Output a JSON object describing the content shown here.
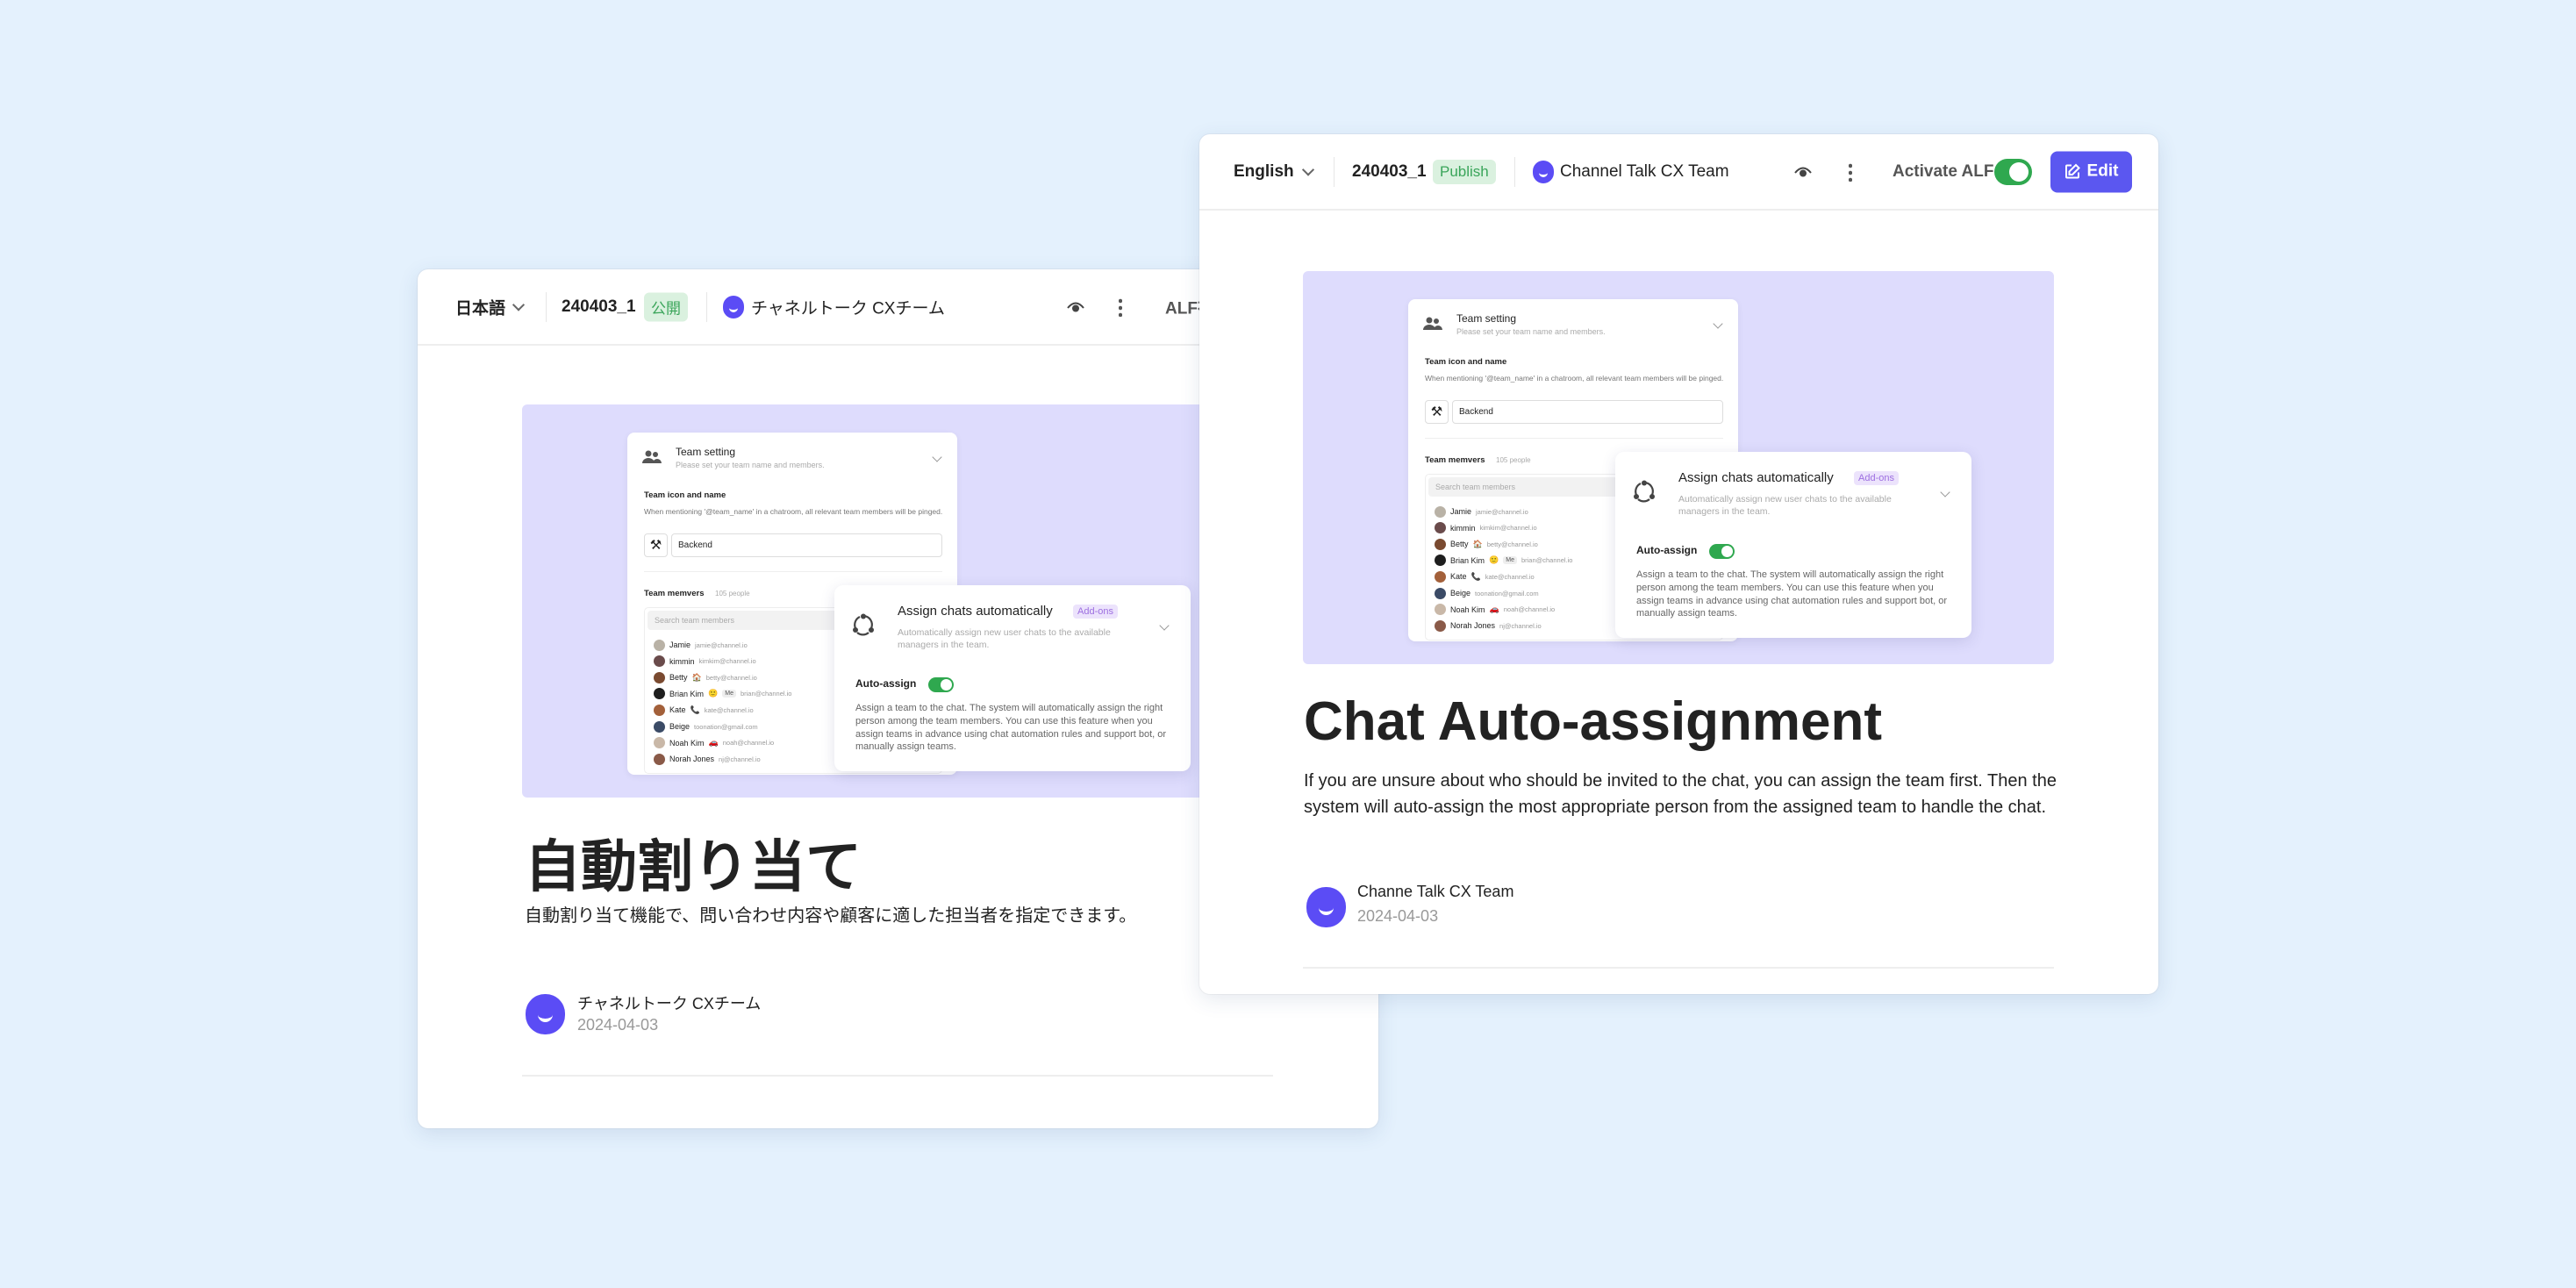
{
  "background_color": "#e4f1fd",
  "accent_color": "#5b57f0",
  "ja": {
    "header": {
      "language": "日本語",
      "version": "240403_1",
      "status": "公開",
      "team": "チャネルトーク CXチーム",
      "alf_label": "ALF有"
    },
    "title": "自動割り当て",
    "description": "自動割り当て機能で、問い合わせ内容や顧客に適した担当者を指定できます。",
    "author": {
      "name": "チャネルトーク CXチーム",
      "date": "2024-04-03"
    }
  },
  "en": {
    "header": {
      "language": "English",
      "version": "240403_1",
      "status": "Publish",
      "team": "Channel Talk CX Team",
      "alf_label": "Activate ALF",
      "alf_enabled": true,
      "edit_label": "Edit"
    },
    "title": "Chat Auto-assignment",
    "description": "If you are unsure about who should be invited to the chat, you can assign the team first. Then the system will auto-assign the most appropriate person from the assigned team to handle the chat.",
    "author": {
      "name": "Channe Talk CX Team",
      "date": "2024-04-03"
    }
  },
  "mockup": {
    "team_setting": {
      "title": "Team setting",
      "subtitle": "Please set your team name and members.",
      "icon_name_label": "Team icon and name",
      "icon_name_desc": "When mentioning '@team_name' in a chatroom, all relevant team members will be pinged.",
      "team_icon": "⚒",
      "team_name_value": "Backend",
      "members_label": "Team memvers",
      "members_count": "105 people",
      "search_placeholder": "Search team members",
      "members": [
        {
          "name": "Jamie",
          "email": "jamie@channel.io",
          "emoji": "",
          "me": "",
          "color": "#b9b2a6"
        },
        {
          "name": "kimmin",
          "email": "kimkim@channel.io",
          "emoji": "",
          "me": "",
          "color": "#6a4b4b"
        },
        {
          "name": "Betty",
          "email": "betty@channel.io",
          "emoji": "🏠",
          "me": "",
          "color": "#7a4a30"
        },
        {
          "name": "Brian Kim",
          "email": "brian@channel.io",
          "emoji": "🙂",
          "me": "Me",
          "color": "#1e1e1e"
        },
        {
          "name": "Kate",
          "email": "kate@channel.io",
          "emoji": "📞",
          "me": "",
          "color": "#a3603a"
        },
        {
          "name": "Beige",
          "email": "toonation@gmail.com",
          "emoji": "",
          "me": "",
          "color": "#3b4b66"
        },
        {
          "name": "Noah Kim",
          "email": "noah@channel.io",
          "emoji": "🚗",
          "me": "",
          "color": "#c9b8a8"
        },
        {
          "name": "Norah Jones",
          "email": "nj@channel.io",
          "emoji": "",
          "me": "",
          "color": "#8a5a48"
        }
      ]
    },
    "assign": {
      "title": "Assign chats automatically",
      "badge": "Add-ons",
      "subtitle": "Automatically assign new user chats to the available managers in the team.",
      "auto_assign_label": "Auto-assign",
      "auto_assign_enabled": true,
      "description": "Assign a team to the chat. The system will automatically assign the right person among the team members. You can use this feature when you assign teams in advance using chat automation rules and support bot, or manually assign teams."
    }
  }
}
